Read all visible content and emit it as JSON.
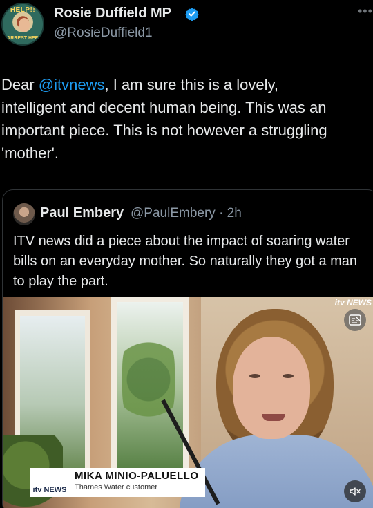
{
  "author": {
    "avatar_text_top": "HELP!!",
    "avatar_text_bottom": "ARREST HER",
    "display_name": "Rosie Duffield MP",
    "handle": "@RosieDuffield1",
    "verified": true
  },
  "tweet": {
    "lines": [
      {
        "pre": "Dear ",
        "mention": "@itvnews",
        "post": ", I am sure this is a lovely,"
      },
      {
        "text": "intelligent and decent human being. This was an"
      },
      {
        "text": "important piece. This is not however a struggling"
      },
      {
        "text": "'mother'."
      }
    ]
  },
  "quoted_tweet": {
    "display_name": "Paul Embery",
    "handle": "@PaulEmbery",
    "separator": "·",
    "time": "2h",
    "text": "ITV news did a piece about the impact of soaring water bills on an everyday mother. So naturally they got a man to play the part."
  },
  "video": {
    "corner_logo": "itv NEWS",
    "lower_third_logo": "itv NEWS",
    "name": "MIKA MINIO-PALUELLO",
    "role": "Thames Water customer",
    "icons": {
      "captions": "captions-icon",
      "mute": "mute-icon"
    }
  },
  "colors": {
    "background": "#000000",
    "text": "#e7e9ea",
    "secondary": "#8b98a5",
    "mention": "#1d9bf0",
    "verified": "#1d9bf0",
    "border": "#2f3336"
  }
}
